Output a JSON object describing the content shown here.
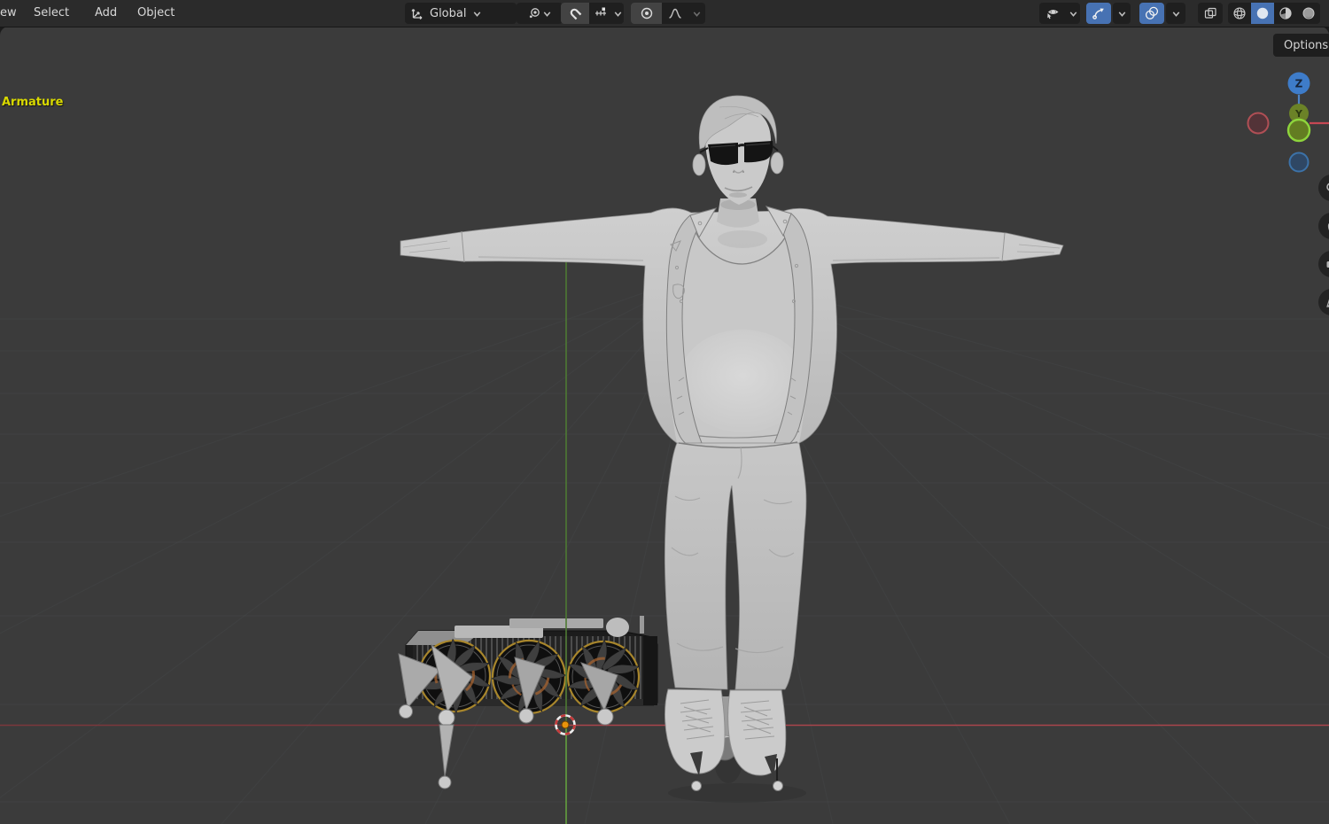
{
  "header": {
    "menus": [
      {
        "label": "ew"
      },
      {
        "label": "Select"
      },
      {
        "label": "Add"
      },
      {
        "label": "Object"
      }
    ],
    "transform_orientation": {
      "value": "Global"
    },
    "snap": {
      "enabled": true
    },
    "proportional_edit": {
      "enabled": true
    },
    "right_toggles": {
      "gizmos_enabled": true,
      "overlays_enabled": true,
      "xray_enabled": false,
      "shading_active": "solid"
    }
  },
  "tool_settings": {
    "options_label": "Options"
  },
  "viewport": {
    "active_object_label": "Armature",
    "axis_gizmo": {
      "z": "Z",
      "y": "Y"
    }
  },
  "colors": {
    "accent_blue": "#4772b3",
    "axis_x_red": "#aa454c",
    "axis_y_green": "#64a03e",
    "armature_label_yellow": "#d9d900",
    "cursor_orange": "#e8930c",
    "viewport_bg": "#3b3b3b",
    "header_bg": "#2b2b2b"
  }
}
